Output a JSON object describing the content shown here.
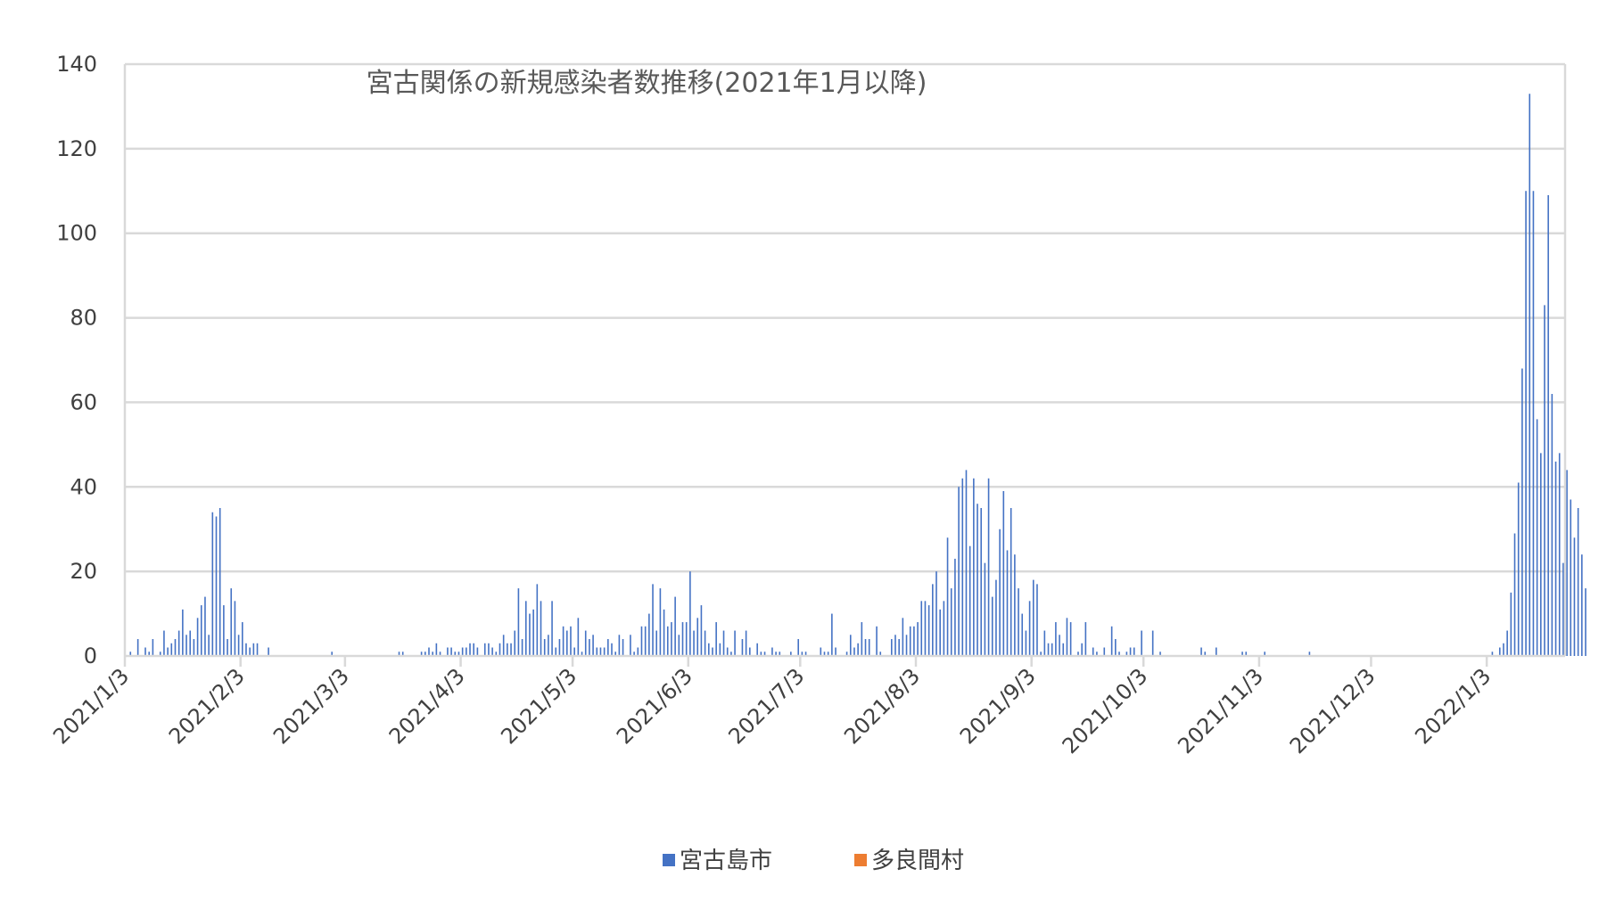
{
  "chart_data": {
    "type": "bar",
    "title": "宮古関係の新規感染者数推移(2021年1月以降)",
    "xlabel": "",
    "ylabel": "",
    "ylim": [
      0,
      140
    ],
    "yticks": [
      0,
      20,
      40,
      60,
      80,
      100,
      120,
      140
    ],
    "x_start": "2021/1/3",
    "x_end": "2022/1/23",
    "xticks": [
      "2021/1/3",
      "2021/2/3",
      "2021/3/3",
      "2021/4/3",
      "2021/5/3",
      "2021/6/3",
      "2021/7/3",
      "2021/8/3",
      "2021/9/3",
      "2021/10/3",
      "2021/11/3",
      "2021/12/3",
      "2022/1/3"
    ],
    "grid": true,
    "legend_position": "bottom",
    "colors": {
      "miyakojima": "#4472C4",
      "taramason": "#ED7D31",
      "grid": "#D9D9D9",
      "axis": "#D9D9D9"
    },
    "series": [
      {
        "name": "宮古島市",
        "color_key": "miyakojima",
        "values": [
          [
            1,
            1
          ],
          [
            3,
            4
          ],
          [
            5,
            2
          ],
          [
            6,
            1
          ],
          [
            7,
            4
          ],
          [
            9,
            1
          ],
          [
            10,
            6
          ],
          [
            11,
            2
          ],
          [
            12,
            3
          ],
          [
            13,
            4
          ],
          [
            14,
            6
          ],
          [
            15,
            11
          ],
          [
            16,
            5
          ],
          [
            17,
            6
          ],
          [
            18,
            4
          ],
          [
            19,
            9
          ],
          [
            20,
            12
          ],
          [
            21,
            14
          ],
          [
            22,
            5
          ],
          [
            23,
            34
          ],
          [
            24,
            33
          ],
          [
            25,
            35
          ],
          [
            26,
            12
          ],
          [
            27,
            4
          ],
          [
            28,
            16
          ],
          [
            29,
            13
          ],
          [
            30,
            5
          ],
          [
            31,
            8
          ],
          [
            32,
            3
          ],
          [
            33,
            2
          ],
          [
            34,
            3
          ],
          [
            35,
            3
          ],
          [
            38,
            2
          ],
          [
            55,
            1
          ],
          [
            73,
            1
          ],
          [
            74,
            1
          ],
          [
            79,
            1
          ],
          [
            80,
            1
          ],
          [
            81,
            2
          ],
          [
            82,
            1
          ],
          [
            83,
            3
          ],
          [
            84,
            1
          ],
          [
            86,
            2
          ],
          [
            87,
            2
          ],
          [
            88,
            1
          ],
          [
            89,
            1
          ],
          [
            90,
            2
          ],
          [
            91,
            2
          ],
          [
            92,
            3
          ],
          [
            93,
            3
          ],
          [
            94,
            2
          ],
          [
            96,
            3
          ],
          [
            97,
            3
          ],
          [
            98,
            2
          ],
          [
            99,
            1
          ],
          [
            100,
            3
          ],
          [
            101,
            5
          ],
          [
            102,
            3
          ],
          [
            103,
            3
          ],
          [
            104,
            6
          ],
          [
            105,
            16
          ],
          [
            106,
            4
          ],
          [
            107,
            13
          ],
          [
            108,
            10
          ],
          [
            109,
            11
          ],
          [
            110,
            17
          ],
          [
            111,
            13
          ],
          [
            112,
            4
          ],
          [
            113,
            5
          ],
          [
            114,
            13
          ],
          [
            115,
            2
          ],
          [
            116,
            4
          ],
          [
            117,
            7
          ],
          [
            118,
            6
          ],
          [
            119,
            7
          ],
          [
            120,
            2
          ],
          [
            121,
            9
          ],
          [
            122,
            1
          ],
          [
            123,
            6
          ],
          [
            124,
            4
          ],
          [
            125,
            5
          ],
          [
            126,
            2
          ],
          [
            127,
            2
          ],
          [
            128,
            2
          ],
          [
            129,
            4
          ],
          [
            130,
            3
          ],
          [
            131,
            1
          ],
          [
            132,
            5
          ],
          [
            133,
            4
          ],
          [
            135,
            5
          ],
          [
            136,
            1
          ],
          [
            137,
            2
          ],
          [
            138,
            7
          ],
          [
            139,
            7
          ],
          [
            140,
            10
          ],
          [
            141,
            17
          ],
          [
            142,
            6
          ],
          [
            143,
            16
          ],
          [
            144,
            11
          ],
          [
            145,
            7
          ],
          [
            146,
            8
          ],
          [
            147,
            14
          ],
          [
            148,
            5
          ],
          [
            149,
            8
          ],
          [
            150,
            8
          ],
          [
            151,
            20
          ],
          [
            152,
            6
          ],
          [
            153,
            9
          ],
          [
            154,
            12
          ],
          [
            155,
            6
          ],
          [
            156,
            3
          ],
          [
            157,
            2
          ],
          [
            158,
            8
          ],
          [
            159,
            3
          ],
          [
            160,
            6
          ],
          [
            161,
            2
          ],
          [
            162,
            1
          ],
          [
            163,
            6
          ],
          [
            165,
            4
          ],
          [
            166,
            6
          ],
          [
            167,
            2
          ],
          [
            169,
            3
          ],
          [
            170,
            1
          ],
          [
            171,
            1
          ],
          [
            173,
            2
          ],
          [
            174,
            1
          ],
          [
            175,
            1
          ],
          [
            178,
            1
          ],
          [
            180,
            4
          ],
          [
            181,
            1
          ],
          [
            182,
            1
          ],
          [
            186,
            2
          ],
          [
            187,
            1
          ],
          [
            188,
            1
          ],
          [
            189,
            10
          ],
          [
            190,
            2
          ],
          [
            193,
            1
          ],
          [
            194,
            5
          ],
          [
            195,
            2
          ],
          [
            196,
            3
          ],
          [
            197,
            8
          ],
          [
            198,
            4
          ],
          [
            199,
            4
          ],
          [
            201,
            7
          ],
          [
            202,
            1
          ],
          [
            205,
            4
          ],
          [
            206,
            5
          ],
          [
            207,
            4
          ],
          [
            208,
            9
          ],
          [
            209,
            5
          ],
          [
            210,
            7
          ],
          [
            211,
            7
          ],
          [
            212,
            8
          ],
          [
            213,
            13
          ],
          [
            214,
            13
          ],
          [
            215,
            12
          ],
          [
            216,
            17
          ],
          [
            217,
            20
          ],
          [
            218,
            11
          ],
          [
            219,
            13
          ],
          [
            220,
            28
          ],
          [
            221,
            16
          ],
          [
            222,
            23
          ],
          [
            223,
            40
          ],
          [
            224,
            42
          ],
          [
            225,
            44
          ],
          [
            226,
            26
          ],
          [
            227,
            42
          ],
          [
            228,
            36
          ],
          [
            229,
            35
          ],
          [
            230,
            22
          ],
          [
            231,
            42
          ],
          [
            232,
            14
          ],
          [
            233,
            18
          ],
          [
            234,
            30
          ],
          [
            235,
            39
          ],
          [
            236,
            25
          ],
          [
            237,
            35
          ],
          [
            238,
            24
          ],
          [
            239,
            16
          ],
          [
            240,
            10
          ],
          [
            241,
            6
          ],
          [
            242,
            13
          ],
          [
            243,
            18
          ],
          [
            244,
            17
          ],
          [
            245,
            1
          ],
          [
            246,
            6
          ],
          [
            247,
            3
          ],
          [
            248,
            3
          ],
          [
            249,
            8
          ],
          [
            250,
            5
          ],
          [
            251,
            3
          ],
          [
            252,
            9
          ],
          [
            253,
            8
          ],
          [
            255,
            1
          ],
          [
            256,
            3
          ],
          [
            257,
            8
          ],
          [
            259,
            2
          ],
          [
            260,
            1
          ],
          [
            262,
            2
          ],
          [
            264,
            7
          ],
          [
            265,
            4
          ],
          [
            266,
            1
          ],
          [
            268,
            1
          ],
          [
            269,
            2
          ],
          [
            270,
            2
          ],
          [
            272,
            6
          ],
          [
            275,
            6
          ],
          [
            277,
            1
          ],
          [
            288,
            2
          ],
          [
            289,
            1
          ],
          [
            292,
            2
          ],
          [
            299,
            1
          ],
          [
            300,
            1
          ],
          [
            305,
            1
          ],
          [
            317,
            1
          ],
          [
            366,
            1
          ],
          [
            368,
            2
          ],
          [
            369,
            3
          ],
          [
            370,
            6
          ],
          [
            371,
            15
          ],
          [
            372,
            29
          ],
          [
            373,
            41
          ],
          [
            374,
            68
          ],
          [
            375,
            110
          ],
          [
            376,
            133
          ],
          [
            377,
            110
          ],
          [
            378,
            56
          ],
          [
            379,
            48
          ],
          [
            380,
            83
          ],
          [
            381,
            109
          ],
          [
            382,
            62
          ],
          [
            383,
            46
          ],
          [
            384,
            48
          ],
          [
            385,
            22
          ],
          [
            386,
            44
          ],
          [
            387,
            37
          ],
          [
            388,
            28
          ],
          [
            389,
            35
          ],
          [
            390,
            24
          ],
          [
            391,
            16
          ]
        ]
      },
      {
        "name": "多良間村",
        "color_key": "taramason",
        "values": []
      }
    ]
  },
  "legend": {
    "items": [
      "宮古島市",
      "多良間村"
    ]
  }
}
